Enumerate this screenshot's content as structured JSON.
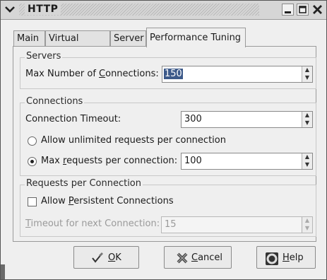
{
  "window": {
    "title": "HTTP"
  },
  "tabs": [
    {
      "label": "Main"
    },
    {
      "label": "Virtual Hosts"
    },
    {
      "label": "Server"
    },
    {
      "label": "Performance Tuning",
      "active": true
    }
  ],
  "servers": {
    "frame_label": "Servers",
    "max_connections_prefix": "Max Number of ",
    "max_connections_mnemonic": "C",
    "max_connections_suffix": "onnections:",
    "max_connections_value": "150"
  },
  "connections": {
    "frame_label": "Connections",
    "timeout_label": "Connection Timeout:",
    "timeout_value": "300",
    "unlimited_label": "Allow unlimited requests per connection",
    "unlimited_selected": false,
    "max_requests_prefix": "Max ",
    "max_requests_mnemonic": "r",
    "max_requests_suffix": "equests per connection:",
    "max_requests_value": "100",
    "max_requests_selected": true
  },
  "requests": {
    "frame_label": "Requests per Connection",
    "persistent_prefix": "Allow ",
    "persistent_mnemonic": "P",
    "persistent_suffix": "ersistent Connections",
    "persistent_checked": false,
    "next_timeout_mnemonic": "T",
    "next_timeout_suffix": "imeout for next Connection:",
    "next_timeout_value": "15"
  },
  "buttons": {
    "ok_mnemonic": "O",
    "ok_suffix": "K",
    "cancel_mnemonic": "C",
    "cancel_suffix": "ancel",
    "help_mnemonic": "H",
    "help_suffix": "elp"
  },
  "icons": {
    "window_menu": "chevron-down-icon",
    "minimize": "minimize-icon",
    "maximize": "maximize-icon",
    "close": "close-icon",
    "ok": "checkmark-pen-icon",
    "cancel": "cancel-x-icon",
    "help": "lifebuoy-icon"
  }
}
